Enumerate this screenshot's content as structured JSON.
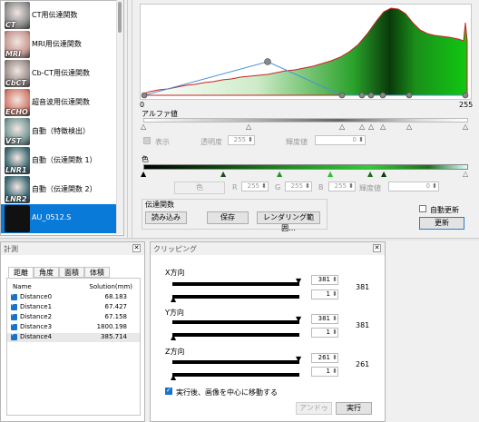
{
  "presets": [
    {
      "thumb_label": "CT",
      "label": "CT用伝達関数",
      "thumb_color": "#8f8f8f"
    },
    {
      "thumb_label": "MRI",
      "label": "MRI用伝達関数",
      "thumb_color": "#c89a92"
    },
    {
      "thumb_label": "CbCT",
      "label": "Cb-CT用伝達関数",
      "thumb_color": "#9b8f8c"
    },
    {
      "thumb_label": "ECHO",
      "label": "超音波用伝達関数",
      "thumb_color": "#d27e6f"
    },
    {
      "thumb_label": "VST",
      "label": "自動（特徴検出）",
      "thumb_color": "#7a9b9a"
    },
    {
      "thumb_label": "LNR1",
      "label": "自動（伝達関数 1）",
      "thumb_color": "#3e6a73"
    },
    {
      "thumb_label": "LNR2",
      "label": "自動（伝達関数 2）",
      "thumb_color": "#3c6a74"
    },
    {
      "thumb_label": "",
      "label": "AU_0512.S",
      "thumb_color": "#101010",
      "selected": true
    }
  ],
  "editor": {
    "scale_min": "0",
    "scale_max": "255",
    "alpha_header": "アルファ値",
    "display_label": "表示",
    "opacity_label": "透明度",
    "opacity_value": "255",
    "luminance_label": "輝度値",
    "luminance_value": "0",
    "color_header": "色",
    "color_button": "色",
    "r_label": "R",
    "r_value": "255",
    "g_label": "G",
    "g_value": "255",
    "b_label": "B",
    "b_value": "255",
    "luminance2_label": "輝度値",
    "luminance2_value": "0",
    "tf_header": "伝達関数",
    "load_button": "読み込み",
    "save_button": "保存",
    "render_range_button": "レンダリング範囲...",
    "auto_update_label": "自動更新",
    "update_button": "更新"
  },
  "measure": {
    "title": "計測",
    "tabs": [
      "距離",
      "角度",
      "面積",
      "体積"
    ],
    "col_name": "Name",
    "col_solution": "Solution(mm)",
    "rows": [
      {
        "name": "Distance0",
        "value": "68.183"
      },
      {
        "name": "Distance1",
        "value": "67.427"
      },
      {
        "name": "Distance2",
        "value": "67.158"
      },
      {
        "name": "Distance3",
        "value": "1800.198"
      },
      {
        "name": "Distance4",
        "value": "385.714"
      }
    ]
  },
  "clipping": {
    "title": "クリッピング",
    "x_label": "X方向",
    "x_max": "381",
    "x_min": "1",
    "x_total": "381",
    "y_label": "Y方向",
    "y_max": "381",
    "y_min": "1",
    "y_total": "381",
    "z_label": "Z方向",
    "z_max": "261",
    "z_min": "1",
    "z_total": "261",
    "move_label": "実行後、画像を中心に移動する",
    "undo_button": "アンドゥ",
    "exec_button": "実行"
  }
}
